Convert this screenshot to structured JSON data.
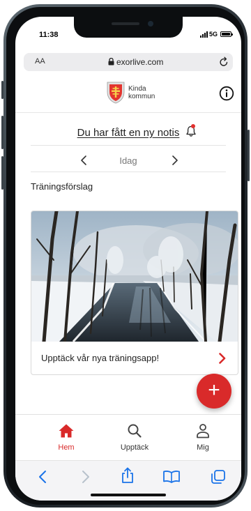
{
  "status_bar": {
    "time": "11:38",
    "network": "5G"
  },
  "browser": {
    "text_size_label": "AA",
    "url": "exorlive.com"
  },
  "site": {
    "brand_line1": "Kinda",
    "brand_line2": "kommun",
    "notification_link": "Du har fått en ny notis",
    "date_label": "Idag",
    "section_title": "Träningsförslag",
    "card_title": "Upptäck vår nya träningsapp!",
    "fab_label": "+"
  },
  "tabs": [
    {
      "label": "Hem",
      "icon": "home-icon",
      "active": true
    },
    {
      "label": "Upptäck",
      "icon": "search-icon",
      "active": false
    },
    {
      "label": "Mig",
      "icon": "person-icon",
      "active": false
    }
  ],
  "colors": {
    "accent": "#d92a2a",
    "safari_blue": "#1a73e8"
  }
}
